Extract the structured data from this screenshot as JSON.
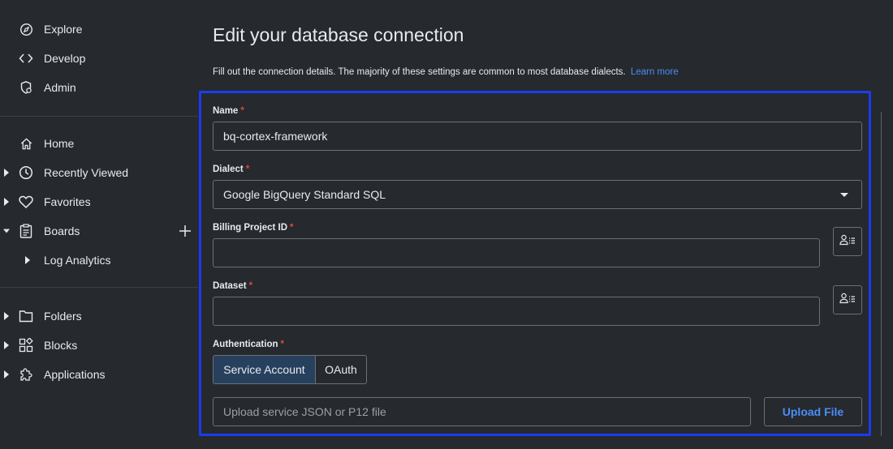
{
  "sidebar": {
    "top_items": [
      {
        "label": "Explore",
        "icon": "compass-icon"
      },
      {
        "label": "Develop",
        "icon": "code-icon"
      },
      {
        "label": "Admin",
        "icon": "admin-gear-icon"
      }
    ],
    "main_items": [
      {
        "label": "Home",
        "icon": "home-icon"
      },
      {
        "label": "Recently Viewed",
        "icon": "clock-icon"
      },
      {
        "label": "Favorites",
        "icon": "heart-icon"
      },
      {
        "label": "Boards",
        "icon": "clipboard-icon"
      },
      {
        "label": "Log Analytics"
      }
    ],
    "bottom_items": [
      {
        "label": "Folders",
        "icon": "folder-icon"
      },
      {
        "label": "Blocks",
        "icon": "blocks-icon"
      },
      {
        "label": "Applications",
        "icon": "puzzle-icon"
      }
    ]
  },
  "page": {
    "title": "Edit your database connection",
    "subtitle": "Fill out the connection details. The majority of these settings are common to most database dialects.",
    "learn_more": "Learn more"
  },
  "form": {
    "name": {
      "label": "Name",
      "required": "*",
      "value": "bq-cortex-framework"
    },
    "dialect": {
      "label": "Dialect",
      "required": "*",
      "value": "Google BigQuery Standard SQL"
    },
    "billing_project": {
      "label": "Billing Project ID",
      "required": "*",
      "value": ""
    },
    "dataset": {
      "label": "Dataset",
      "required": "*",
      "value": ""
    },
    "authentication": {
      "label": "Authentication",
      "required": "*",
      "options": [
        "Service Account",
        "OAuth"
      ],
      "selected": "Service Account"
    },
    "upload": {
      "placeholder": "Upload service JSON or P12 file",
      "button": "Upload File"
    }
  },
  "colors": {
    "background": "#26292e",
    "accent": "#4c8df6",
    "highlight_border": "#1a3cf0",
    "required": "#ea4335",
    "segment_active": "#27405e"
  }
}
